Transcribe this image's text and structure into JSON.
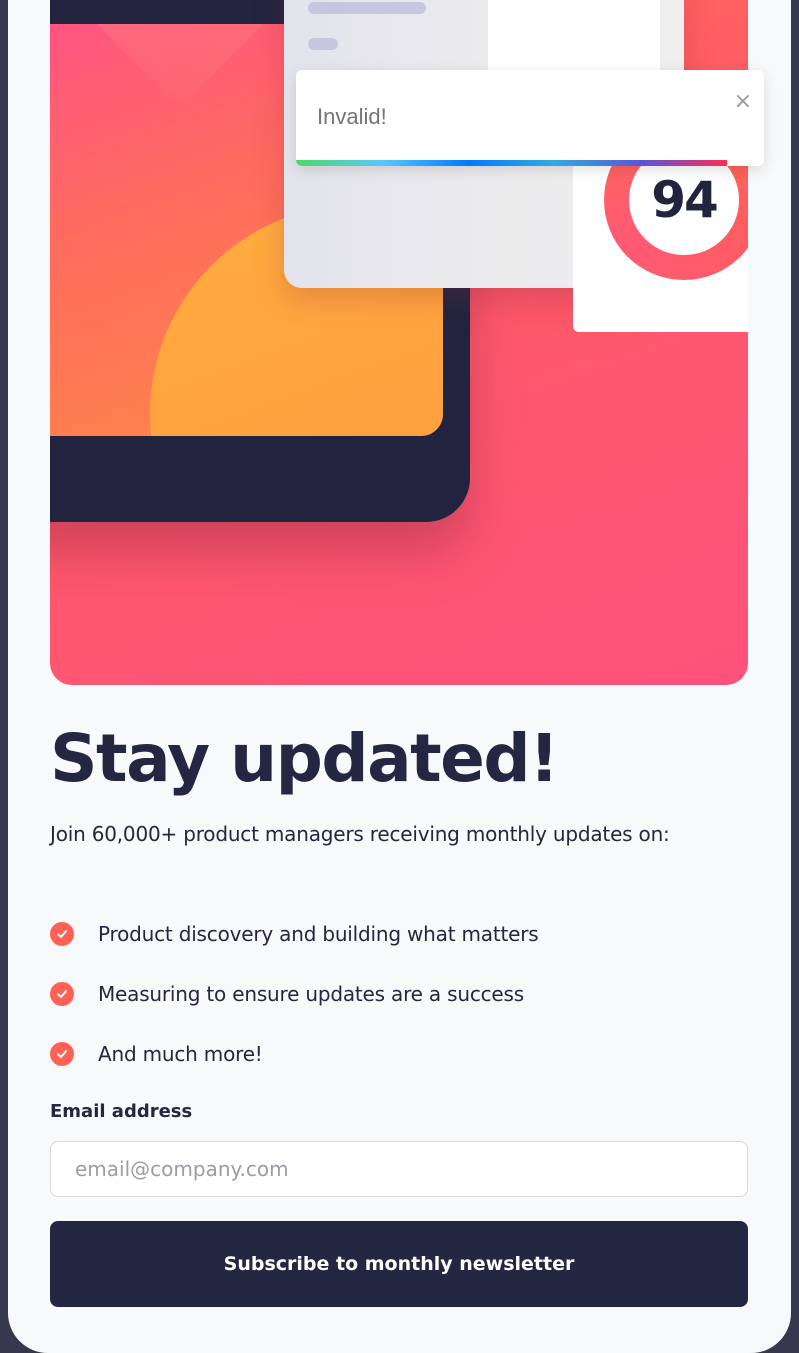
{
  "toast": {
    "message": "Invalid!",
    "close_glyph": "×",
    "progress": 0.92
  },
  "illustration": {
    "score": "94"
  },
  "content": {
    "title": "Stay updated!",
    "intro": "Join 60,000+ product managers receiving monthly updates on:",
    "features": [
      "Product discovery and building what matters",
      "Measuring to ensure updates are a success",
      "And much more!"
    ]
  },
  "form": {
    "email_label": "Email address",
    "email_placeholder": "email@company.com",
    "email_value": "",
    "submit_label": "Subscribe to monthly newsletter"
  },
  "colors": {
    "accent": "#ff6155",
    "dark": "#242742",
    "background": "#36384e"
  },
  "icons": [
    "close-icon",
    "check-icon"
  ]
}
